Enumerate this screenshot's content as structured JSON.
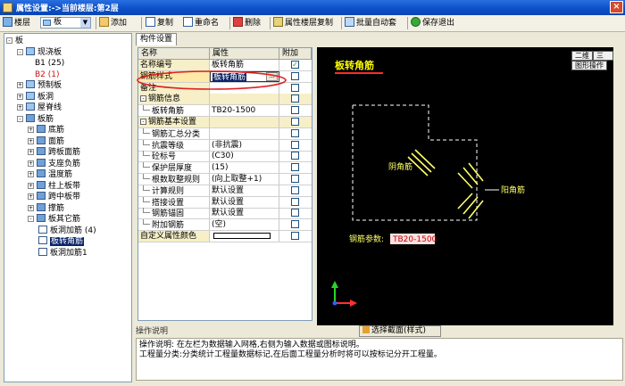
{
  "window": {
    "title": "属性设置:->当前楼层:第2层",
    "close_label": "×"
  },
  "toolbar": {
    "layer_label": "楼层",
    "component_value": "板",
    "add_label": "添加",
    "copy_label": "复制",
    "rename_label": "重命名",
    "delete_label": "删除",
    "layer_copy_label": "属性楼层复制",
    "batch_label": "批量自动套",
    "save_exit_label": "保存退出"
  },
  "tree": {
    "items": [
      {
        "label": "板",
        "toggle": "-",
        "color": "#000000"
      },
      {
        "label": "现浇板",
        "toggle": "-",
        "color": "#000000"
      },
      {
        "label": "B1 (25)",
        "toggle": "",
        "color": "#000000"
      },
      {
        "label": "B2 (1)",
        "toggle": "",
        "color": "#d01010"
      },
      {
        "label": "预制板",
        "toggle": "+",
        "color": "#000000"
      },
      {
        "label": "板洞",
        "toggle": "+",
        "color": "#000000"
      },
      {
        "label": "屋脊线",
        "toggle": "+",
        "color": "#000000"
      },
      {
        "label": "板筋",
        "toggle": "-",
        "color": "#000000"
      },
      {
        "label": "底筋",
        "toggle": "+",
        "color": "#000000"
      },
      {
        "label": "面筋",
        "toggle": "+",
        "color": "#000000"
      },
      {
        "label": "跨板面筋",
        "toggle": "+",
        "color": "#000000"
      },
      {
        "label": "支座负筋",
        "toggle": "+",
        "color": "#000000"
      },
      {
        "label": "温度筋",
        "toggle": "+",
        "color": "#000000"
      },
      {
        "label": "柱上板带",
        "toggle": "+",
        "color": "#000000"
      },
      {
        "label": "跨中板带",
        "toggle": "+",
        "color": "#000000"
      },
      {
        "label": "撑筋",
        "toggle": "+",
        "color": "#000000"
      },
      {
        "label": "板其它筋",
        "toggle": "-",
        "color": "#000000"
      },
      {
        "label": "板洞加筋 (4)",
        "toggle": "",
        "color": "#000000"
      },
      {
        "label": "板转角筋",
        "toggle": "",
        "color": "#000000"
      },
      {
        "label": "板洞加筋1",
        "toggle": "",
        "color": "#000000"
      }
    ]
  },
  "tabs": {
    "component_settings": "构件设置"
  },
  "grid": {
    "headers": {
      "name": "名称",
      "attr": "属性",
      "attach": "附加"
    },
    "rows": [
      {
        "name": "名称编号",
        "value": "板转角筋",
        "check": true,
        "group": "",
        "style": "plain"
      },
      {
        "name": "钢筋样式",
        "value": "板转角筋",
        "check": false,
        "group": "",
        "style": "edit"
      },
      {
        "name": "备注",
        "value": "",
        "check": false,
        "group": "",
        "style": "plain"
      },
      {
        "name": "钢筋信息",
        "value": "",
        "check": false,
        "group": "-",
        "style": "group"
      },
      {
        "name": "板转角筋",
        "value": "TB20-1500",
        "check": false,
        "group": "",
        "style": "child"
      },
      {
        "name": "钢筋基本设置",
        "value": "",
        "check": false,
        "group": "-",
        "style": "group"
      },
      {
        "name": "钢筋汇总分类",
        "value": "",
        "check": false,
        "group": "",
        "style": "child"
      },
      {
        "name": "抗震等级",
        "value": "(非抗震)",
        "check": false,
        "group": "",
        "style": "child"
      },
      {
        "name": "砼标号",
        "value": "(C30)",
        "check": false,
        "group": "",
        "style": "child"
      },
      {
        "name": "保护层厚度",
        "value": "(15)",
        "check": false,
        "group": "",
        "style": "child"
      },
      {
        "name": "根数取整规则",
        "value": "(向上取整+1)",
        "check": false,
        "group": "",
        "style": "child"
      },
      {
        "name": "计算规则",
        "value": "默认设置",
        "check": false,
        "group": "",
        "style": "child"
      },
      {
        "name": "搭接设置",
        "value": "默认设置",
        "check": false,
        "group": "",
        "style": "child"
      },
      {
        "name": "钢筋锚固",
        "value": "默认设置",
        "check": false,
        "group": "",
        "style": "child"
      },
      {
        "name": "附加钢筋",
        "value": "(空)",
        "check": false,
        "group": "",
        "style": "child"
      },
      {
        "name": "自定义属性颜色",
        "value": "",
        "check": false,
        "group": "",
        "style": "color"
      }
    ],
    "ellipsis": "..."
  },
  "canvas": {
    "title": "板转角筋",
    "btn_2d": "二维",
    "btn_3d": "三维",
    "btn_ops": "图形操作",
    "label_yin": "阴角筋",
    "label_yang": "阳角筋",
    "param_label": "钢筋参数:",
    "param_value": "TB20-1500",
    "title_color": "#ffff00",
    "line_color": "#ffff66"
  },
  "section_select": "选择截面(样式)",
  "status": {
    "header": "操作说明",
    "line1": "操作说明: 在左栏为数据输入网格,右侧为输入数据或图标说明。",
    "line2": "工程量分类:分类统计工程量数据标记,在后面工程量分析时将可以按标记分开工程量。"
  }
}
